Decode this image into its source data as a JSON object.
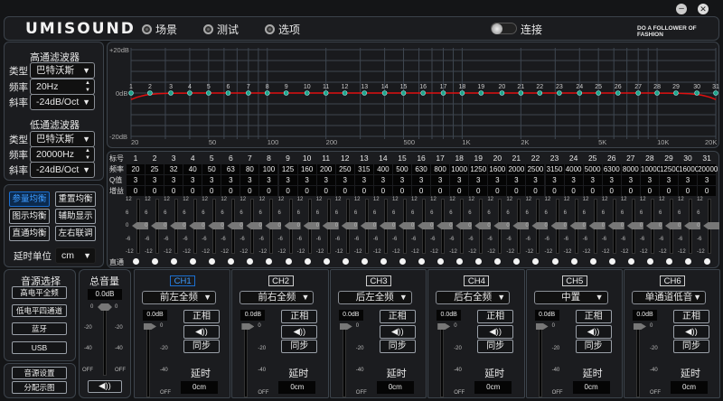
{
  "header": {
    "logo": "UMISOUND",
    "nav": [
      "场景",
      "测试",
      "选项"
    ],
    "connect_label": "连接",
    "connected": false,
    "slogan": "DO A FOLLOWER OF FASHION",
    "minimize": "minimize-icon",
    "close": "close-icon"
  },
  "highpass": {
    "title": "高通滤波器",
    "type_label": "类型",
    "type_value": "巴特沃斯",
    "freq_label": "频率",
    "freq_value": "20Hz",
    "slope_label": "斜率",
    "slope_value": "-24dB/Oct"
  },
  "lowpass": {
    "title": "低通滤波器",
    "type_label": "类型",
    "type_value": "巴特沃斯",
    "freq_label": "频率",
    "freq_value": "20000Hz",
    "slope_label": "斜率",
    "slope_value": "-24dB/Oct"
  },
  "eq_buttons": [
    "参量均衡",
    "重置均衡",
    "图示均衡",
    "辅助显示",
    "直通均衡",
    "左右联调"
  ],
  "delay_unit": {
    "label": "延时单位",
    "value": "cm"
  },
  "graph": {
    "y_labels": [
      "+20dB",
      "0dB",
      "-20dB"
    ],
    "x_labels": [
      "20",
      "50",
      "100",
      "200",
      "500",
      "1K",
      "2K",
      "5K",
      "10K",
      "20K"
    ],
    "curve_color": "#e01010",
    "point_color": "#1fa58a",
    "ylim": [
      -20,
      20
    ],
    "xlim": [
      20,
      20000
    ],
    "scale": "log"
  },
  "table": {
    "row_labels": [
      "标号",
      "频率",
      "Q值",
      "增益"
    ],
    "bypass_label": "直通",
    "slider_ticks": [
      "12",
      "6",
      "0",
      "-6",
      "-12"
    ],
    "bands": [
      "1",
      "2",
      "3",
      "4",
      "5",
      "6",
      "7",
      "8",
      "9",
      "10",
      "11",
      "12",
      "13",
      "14",
      "15",
      "16",
      "17",
      "18",
      "19",
      "20",
      "21",
      "22",
      "23",
      "24",
      "25",
      "26",
      "27",
      "28",
      "29",
      "30",
      "31"
    ],
    "freqs": [
      "20",
      "25",
      "32",
      "40",
      "50",
      "63",
      "80",
      "100",
      "125",
      "160",
      "200",
      "250",
      "315",
      "400",
      "500",
      "630",
      "800",
      "1000",
      "1250",
      "1600",
      "2000",
      "2500",
      "3150",
      "4000",
      "5000",
      "6300",
      "8000",
      "10000",
      "12500",
      "16000",
      "20000"
    ],
    "q": [
      "3",
      "3",
      "3",
      "3",
      "3",
      "3",
      "3",
      "3",
      "3",
      "3",
      "3",
      "3",
      "3",
      "3",
      "3",
      "3",
      "3",
      "3",
      "3",
      "3",
      "3",
      "3",
      "3",
      "3",
      "3",
      "3",
      "3",
      "3",
      "3",
      "3",
      "3"
    ],
    "gain": [
      "0",
      "0",
      "0",
      "0",
      "0",
      "0",
      "0",
      "0",
      "0",
      "0",
      "0",
      "0",
      "0",
      "0",
      "0",
      "0",
      "0",
      "0",
      "0",
      "0",
      "0",
      "0",
      "0",
      "0",
      "0",
      "0",
      "0",
      "0",
      "0",
      "0",
      "0"
    ]
  },
  "source": {
    "title": "音源选择",
    "items": [
      "高电平全频",
      "低电平四通道",
      "蓝牙",
      "USB"
    ],
    "settings": "音源设置",
    "routing": "分配示图"
  },
  "master": {
    "title": "总音量",
    "value": "0.0dB",
    "ticks": [
      "0",
      "-20",
      "-40",
      "OFF"
    ],
    "level_db": 0
  },
  "channels": [
    {
      "name": "CH1",
      "assign": "前左全频",
      "db": "0.0dB",
      "phase": "正相",
      "sync": "同步",
      "delay_label": "延时",
      "delay": "0cm",
      "active": true
    },
    {
      "name": "CH2",
      "assign": "前右全频",
      "db": "0.0dB",
      "phase": "正相",
      "sync": "同步",
      "delay_label": "延时",
      "delay": "0cm"
    },
    {
      "name": "CH3",
      "assign": "后左全频",
      "db": "0.0dB",
      "phase": "正相",
      "sync": "同步",
      "delay_label": "延时",
      "delay": "0cm"
    },
    {
      "name": "CH4",
      "assign": "后右全频",
      "db": "0.0dB",
      "phase": "正相",
      "sync": "同步",
      "delay_label": "延时",
      "delay": "0cm"
    },
    {
      "name": "CH5",
      "assign": "中置",
      "db": "0.0dB",
      "phase": "正相",
      "sync": "同步",
      "delay_label": "延时",
      "delay": "0cm"
    },
    {
      "name": "CH6",
      "assign": "单通道低音",
      "db": "0.0dB",
      "phase": "正相",
      "sync": "同步",
      "delay_label": "延时",
      "delay": "0cm"
    }
  ],
  "channel_ticks": [
    "0",
    "-20",
    "-40",
    "OFF"
  ]
}
